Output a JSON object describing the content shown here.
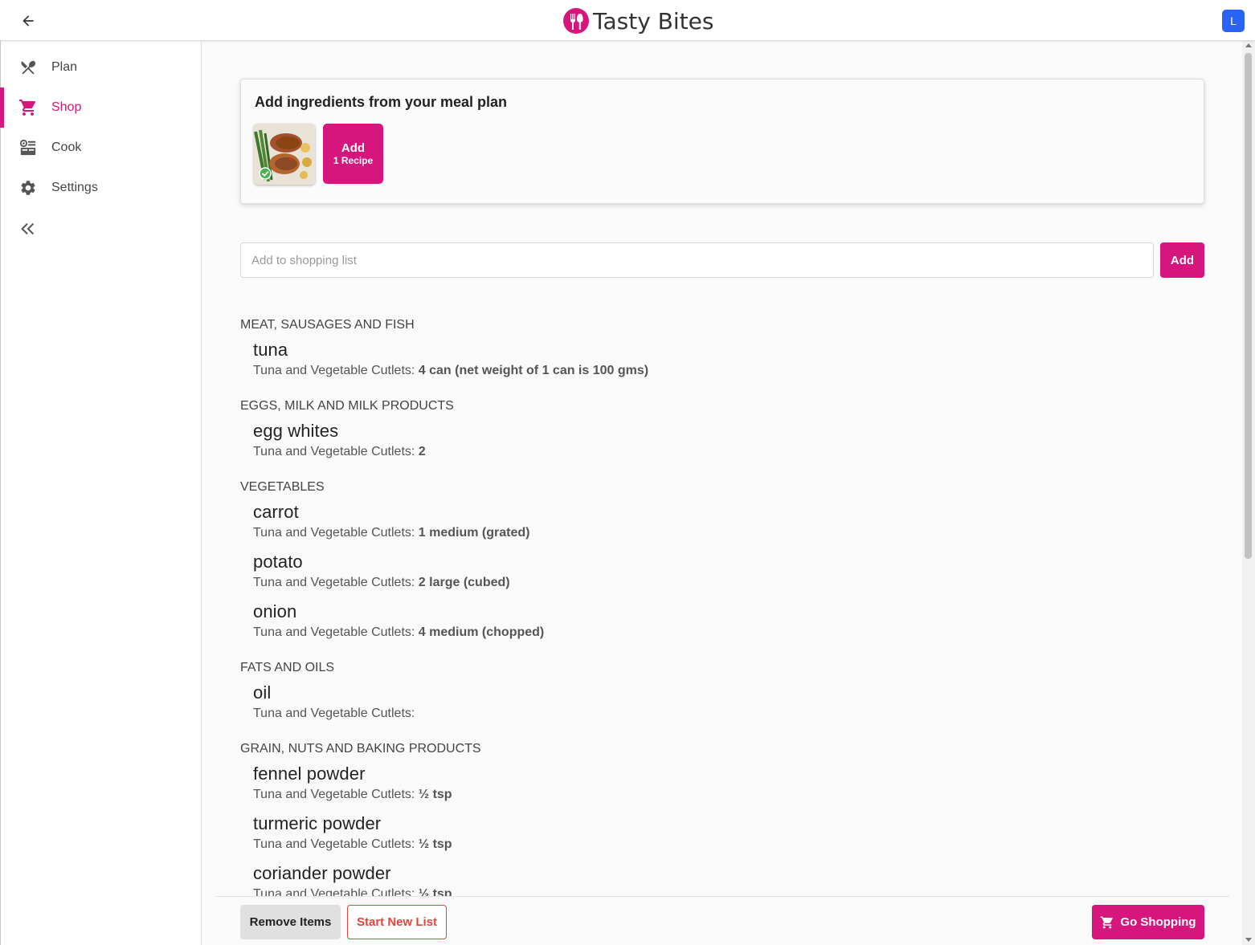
{
  "app": {
    "name": "Tasty Bites",
    "avatar_initial": "L",
    "accent_color": "#d6157d",
    "avatar_color": "#2a63f5"
  },
  "sidebar": {
    "items": [
      {
        "label": "Plan",
        "icon": "fork-knife-icon",
        "active": false
      },
      {
        "label": "Shop",
        "icon": "cart-icon",
        "active": true
      },
      {
        "label": "Cook",
        "icon": "stove-icon",
        "active": false
      },
      {
        "label": "Settings",
        "icon": "gear-icon",
        "active": false
      }
    ],
    "collapse_icon": "double-chevron-left-icon"
  },
  "meal_plan_card": {
    "title": "Add ingredients from your meal plan",
    "add_button_line1": "Add",
    "add_button_line2": "1 Recipe"
  },
  "search": {
    "placeholder": "Add to shopping list",
    "value": "",
    "add_label": "Add"
  },
  "shopping_list": [
    {
      "category": "MEAT, SAUSAGES AND FISH",
      "items": [
        {
          "name": "tuna",
          "recipe": "Tuna and Vegetable Cutlets:",
          "qty": "4 can (net weight of 1 can is 100 gms)"
        }
      ]
    },
    {
      "category": "EGGS, MILK AND MILK PRODUCTS",
      "items": [
        {
          "name": "egg whites",
          "recipe": "Tuna and Vegetable Cutlets:",
          "qty": "2"
        }
      ]
    },
    {
      "category": "VEGETABLES",
      "items": [
        {
          "name": "carrot",
          "recipe": "Tuna and Vegetable Cutlets:",
          "qty": "1 medium (grated)"
        },
        {
          "name": "potato",
          "recipe": "Tuna and Vegetable Cutlets:",
          "qty": "2 large (cubed)"
        },
        {
          "name": "onion",
          "recipe": "Tuna and Vegetable Cutlets:",
          "qty": "4 medium (chopped)"
        }
      ]
    },
    {
      "category": "FATS AND OILS",
      "items": [
        {
          "name": "oil",
          "recipe": "Tuna and Vegetable Cutlets:",
          "qty": ""
        }
      ]
    },
    {
      "category": "GRAIN, NUTS AND BAKING PRODUCTS",
      "items": [
        {
          "name": "fennel powder",
          "recipe": "Tuna and Vegetable Cutlets:",
          "qty": "½ tsp"
        },
        {
          "name": "turmeric powder",
          "recipe": "Tuna and Vegetable Cutlets:",
          "qty": "½ tsp"
        },
        {
          "name": "coriander powder",
          "recipe": "Tuna and Vegetable Cutlets:",
          "qty": "½ tsp"
        }
      ]
    }
  ],
  "bottom_bar": {
    "remove_label": "Remove Items",
    "start_label": "Start New List",
    "go_label": "Go Shopping"
  }
}
